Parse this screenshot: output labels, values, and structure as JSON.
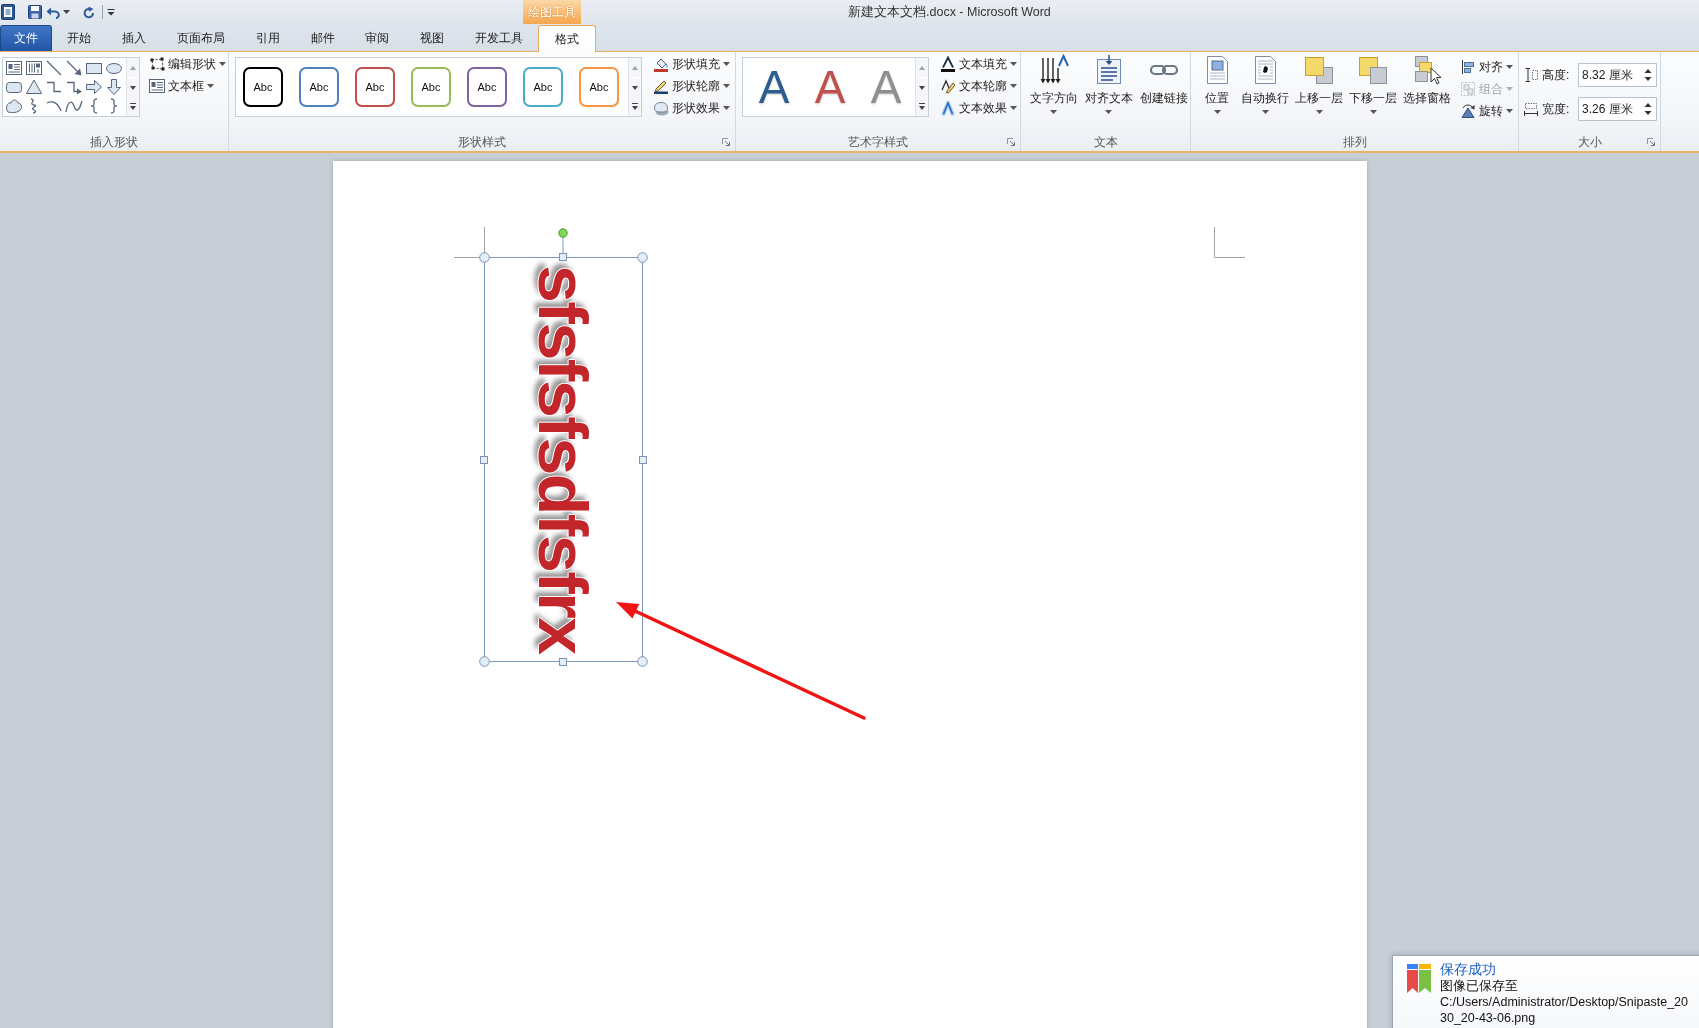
{
  "window": {
    "title": "新建文本文档.docx - Microsoft Word"
  },
  "contextual_group": {
    "label": "绘图工具"
  },
  "tabs": [
    {
      "label": "文件",
      "kind": "file",
      "selected": false
    },
    {
      "label": "开始",
      "kind": "normal",
      "selected": false
    },
    {
      "label": "插入",
      "kind": "normal",
      "selected": false
    },
    {
      "label": "页面布局",
      "kind": "normal",
      "selected": false
    },
    {
      "label": "引用",
      "kind": "normal",
      "selected": false
    },
    {
      "label": "邮件",
      "kind": "normal",
      "selected": false
    },
    {
      "label": "审阅",
      "kind": "normal",
      "selected": false
    },
    {
      "label": "视图",
      "kind": "normal",
      "selected": false
    },
    {
      "label": "开发工具",
      "kind": "normal",
      "selected": false
    },
    {
      "label": "格式",
      "kind": "contextual",
      "selected": true
    }
  ],
  "ribbon": {
    "insert_shapes": {
      "label": "插入形状",
      "commands": [
        {
          "label": "编辑形状"
        },
        {
          "label": "文本框"
        }
      ]
    },
    "shape_styles": {
      "label": "形状样式",
      "styles": [
        {
          "label": "Abc",
          "color": "#000000"
        },
        {
          "label": "Abc",
          "color": "#4f81bd"
        },
        {
          "label": "Abc",
          "color": "#c0504d"
        },
        {
          "label": "Abc",
          "color": "#9bbb59"
        },
        {
          "label": "Abc",
          "color": "#8064a2"
        },
        {
          "label": "Abc",
          "color": "#4bacc6"
        },
        {
          "label": "Abc",
          "color": "#f79646"
        }
      ],
      "commands": [
        {
          "label": "形状填充"
        },
        {
          "label": "形状轮廓"
        },
        {
          "label": "形状效果"
        }
      ]
    },
    "wordart_styles": {
      "label": "艺术字样式",
      "styles": [
        {
          "label": "A",
          "color": "#2c5d8f"
        },
        {
          "label": "A",
          "color": "#c0504d"
        },
        {
          "label": "A",
          "color": "#8f8f8f"
        }
      ],
      "commands": [
        {
          "label": "文本填充"
        },
        {
          "label": "文本轮廓"
        },
        {
          "label": "文本效果"
        }
      ]
    },
    "text": {
      "label": "文本",
      "buttons": [
        {
          "label": "文字方向",
          "dropdown": true
        },
        {
          "label": "对齐文本",
          "dropdown": true
        },
        {
          "label": "创建链接",
          "dropdown": false
        }
      ]
    },
    "arrange": {
      "label": "排列",
      "buttons": [
        {
          "label": "位置",
          "dropdown": true
        },
        {
          "label": "自动换行",
          "dropdown": true
        },
        {
          "label": "上移一层",
          "dropdown": true
        },
        {
          "label": "下移一层",
          "dropdown": true
        },
        {
          "label": "选择窗格",
          "dropdown": false
        }
      ],
      "commands": [
        {
          "label": "对齐",
          "disabled": false
        },
        {
          "label": "组合",
          "disabled": true
        },
        {
          "label": "旋转",
          "disabled": false
        }
      ]
    },
    "size": {
      "label": "大小",
      "fields": [
        {
          "label": "高度:",
          "value": "8.32 厘米"
        },
        {
          "label": "宽度:",
          "value": "3.26 厘米"
        }
      ]
    }
  },
  "document": {
    "text_box": {
      "text": "sfsfsfsdfsfrx",
      "selected": true
    }
  },
  "notification": {
    "title": "保存成功",
    "message": "图像已保存至",
    "path_lines": [
      "C:/Users/Administrator/Desktop/Snipaste_20",
      "30_20-43-06.png"
    ]
  }
}
